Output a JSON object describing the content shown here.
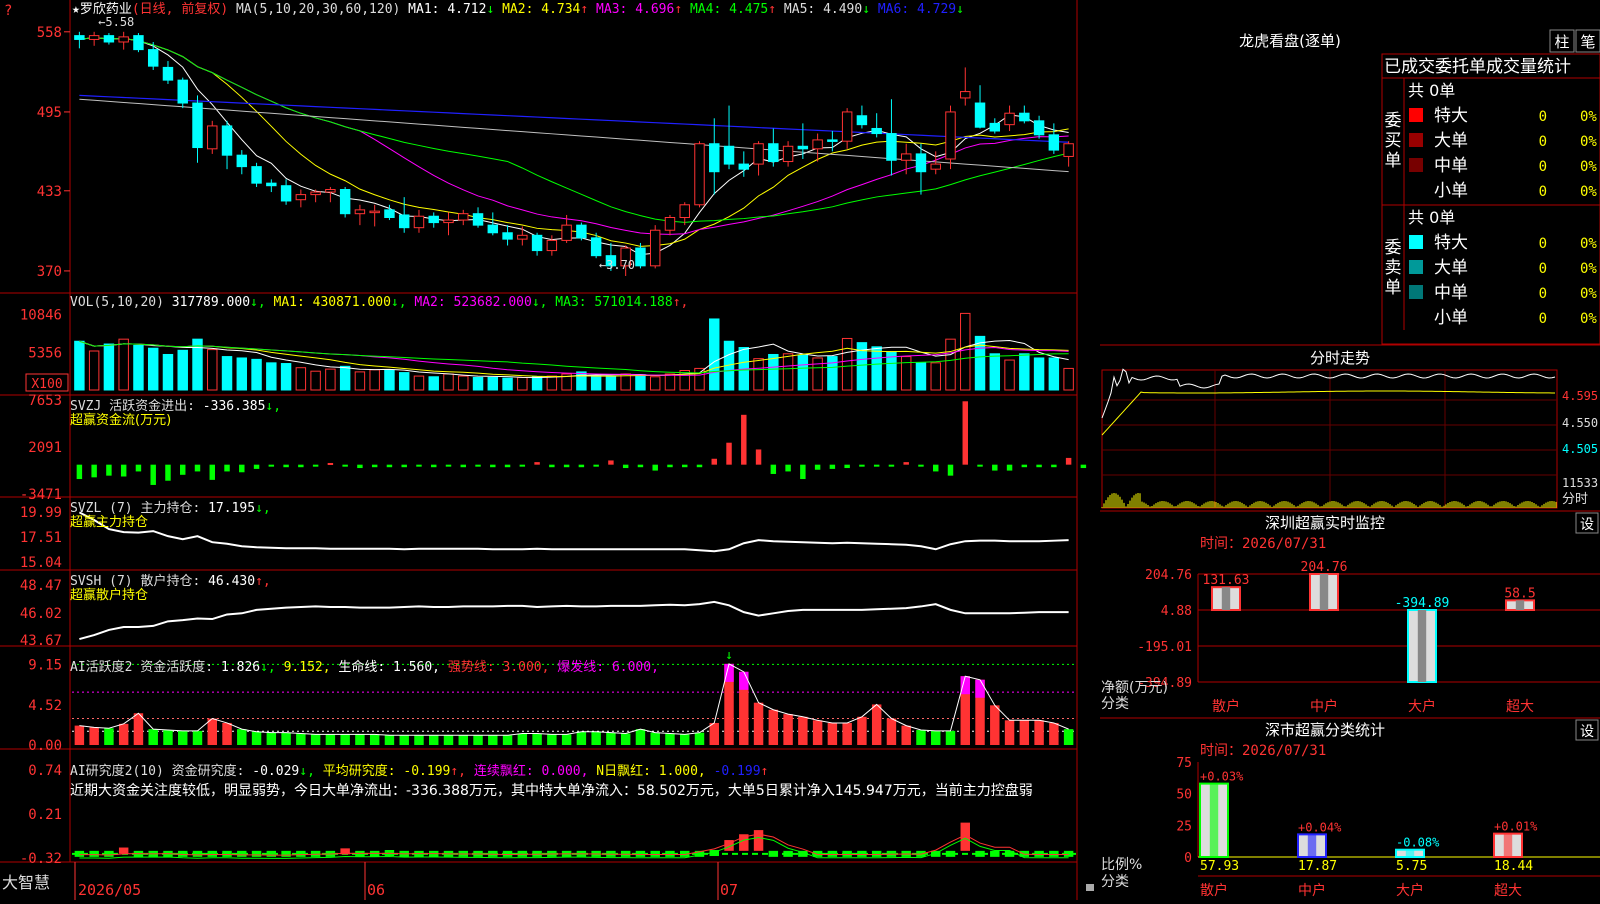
{
  "colors": {
    "up": "#ff3333",
    "down": "#00ffff",
    "ma1": "#ffffff",
    "ma2": "#ffff00",
    "ma3": "#ff00ff",
    "ma4": "#00ff00",
    "ma5": "#c0c0c0",
    "ma6": "#2020ff",
    "grid": "#b00000",
    "cyan": "#00ffff",
    "magenta": "#ff00ff",
    "green": "#00ff00",
    "yellow": "#ffff00",
    "red": "#ff3333"
  },
  "header": {
    "question": "?",
    "star": "★",
    "stock": "罗欣药业",
    "period": "(日线, 前复权)",
    "ma_label": "MA(5,10,20,30,60,120)",
    "mas": [
      {
        "n": "MA1",
        "v": "4.712",
        "a": "↓"
      },
      {
        "n": "MA2",
        "v": "4.734",
        "a": "↑"
      },
      {
        "n": "MA3",
        "v": "4.696",
        "a": "↑"
      },
      {
        "n": "MA4",
        "v": "4.475",
        "a": "↑"
      },
      {
        "n": "MA5",
        "v": "4.490",
        "a": "↓"
      },
      {
        "n": "MA6",
        "v": "4.729",
        "a": "↓"
      }
    ]
  },
  "price": {
    "hi_label": "5.58",
    "lo_label": "3.70",
    "y_labels": [
      "558",
      "495",
      "433",
      "370"
    ],
    "ylim": [
      3.55,
      5.72
    ],
    "high_arrow": "←",
    "low_arrow": "←"
  },
  "vol": {
    "title": "VOL(5,10,20)",
    "value": "317789.000",
    "v_arrow": "↓",
    "mas": [
      {
        "n": "MA1",
        "v": "430871.000",
        "a": "↓"
      },
      {
        "n": "MA2",
        "v": "523682.000",
        "a": "↓"
      },
      {
        "n": "MA3",
        "v": "571014.188",
        "a": "↑"
      }
    ],
    "y_labels": [
      "10846",
      "5356"
    ],
    "unit": "X100"
  },
  "svzj": {
    "code": "SVZJ",
    "name": "活跃资金进出",
    "value": "-336.385",
    "arrow": "↓",
    "sub": "超赢资金流(万元)",
    "y_labels": [
      "7653",
      "2091",
      "-3471"
    ]
  },
  "svzl": {
    "code": "SVZL (7)",
    "name": "主力持仓",
    "value": "17.195",
    "arrow": "↓",
    "sub": "超赢主力持仓",
    "y_labels": [
      "19.99",
      "17.51",
      "15.04"
    ]
  },
  "svsh": {
    "code": "SVSH (7)",
    "name": "散户持仓",
    "value": "46.430",
    "arrow": "↑",
    "sub": "超赢散户持仓",
    "y_labels": [
      "48.47",
      "46.02",
      "43.67"
    ]
  },
  "ai_hyd": {
    "code": "AI活跃度2",
    "name": "资金活跃度",
    "value": "1.826",
    "arrow": "↓",
    "v2": "9.152",
    "life": "生命线",
    "life_v": "1.560",
    "strong": "强势线",
    "strong_v": "3.000",
    "burst": "爆发线",
    "burst_v": "6.000",
    "y_labels": [
      "9.15",
      "4.52",
      "0.00"
    ]
  },
  "ai_yjd": {
    "code": "AI研究度2(10)",
    "name": "资金研究度",
    "value": "-0.029",
    "arrow": "↓",
    "avg": "平均研究度",
    "avg_v": "-0.199",
    "avg_a": "↑",
    "lx": "连续飘红",
    "lx_v": "0.000",
    "nr": "N日飘红",
    "nr_v": "1.000",
    "last": "-0.199",
    "last_a": "↑",
    "y_labels": [
      "0.74",
      "0.21",
      "-0.32"
    ],
    "comment": "近期大资金关注度较低，明显弱势，今日大单净流出：-336.388万元，其中特大单净流入：58.502万元，大单5日累计净入145.947万元，当前主力控盘弱"
  },
  "bottom": {
    "brand": "大智慧",
    "dates": [
      "2026/05",
      "06",
      "07"
    ]
  },
  "dragon": {
    "title": "龙虎看盘(逐单)",
    "btn1": "柱",
    "btn2": "笔",
    "subtitle": "已成交委托单成交量统计",
    "buy": {
      "side": "委买单",
      "total": "共 0单",
      "rows": [
        {
          "name": "特大",
          "n": "0",
          "p": "0%",
          "c": "#ff0000"
        },
        {
          "name": "大单",
          "n": "0",
          "p": "0%",
          "c": "#990000"
        },
        {
          "name": "中单",
          "n": "0",
          "p": "0%",
          "c": "#770000"
        },
        {
          "name": "小单",
          "n": "0",
          "p": "0%",
          "c": ""
        }
      ]
    },
    "sell": {
      "side": "委卖单",
      "total": "共 0单",
      "rows": [
        {
          "name": "特大",
          "n": "0",
          "p": "0%",
          "c": "#00ffff"
        },
        {
          "name": "大单",
          "n": "0",
          "p": "0%",
          "c": "#009999"
        },
        {
          "name": "中单",
          "n": "0",
          "p": "0%",
          "c": "#007777"
        },
        {
          "name": "小单",
          "n": "0",
          "p": "0%",
          "c": ""
        }
      ]
    }
  },
  "intraday": {
    "title": "分时走势",
    "y_labels": [
      "4.595",
      "4.550",
      "4.505"
    ],
    "vol_label": "11533",
    "tag": "分时"
  },
  "monitor": {
    "title": "深圳超赢实时监控",
    "btn": "设",
    "time_label": "时间：",
    "time": "2026/07/31",
    "y_labels": [
      "204.76",
      "4.88",
      "-195.01",
      "-394.89"
    ],
    "left_label": "净额(万元)",
    "cat_label": "分类",
    "bars": [
      {
        "cat": "散户",
        "v": 131.63,
        "label": "131.63"
      },
      {
        "cat": "中户",
        "v": 204.76,
        "label": "204.76"
      },
      {
        "cat": "大户",
        "v": -394.89,
        "label": "-394.89"
      },
      {
        "cat": "超大",
        "v": 58.5,
        "label": "58.5"
      }
    ]
  },
  "classify": {
    "title": "深市超赢分类统计",
    "btn": "设",
    "time_label": "时间：",
    "time": "2026/07/31",
    "y_labels": [
      "75",
      "50",
      "25",
      "0"
    ],
    "left_label": "比例%",
    "cat_label": "分类",
    "bars": [
      {
        "cat": "散户",
        "pct": 57.93,
        "label": "57.93",
        "chg": "+0.03%"
      },
      {
        "cat": "中户",
        "pct": 17.87,
        "label": "17.87",
        "chg": "+0.04%"
      },
      {
        "cat": "大户",
        "pct": 5.75,
        "label": "5.75",
        "chg": "-0.08%"
      },
      {
        "cat": "超大",
        "pct": 18.44,
        "label": "18.44",
        "chg": "+0.01%"
      }
    ]
  },
  "chart_data": {
    "type": "candlestick",
    "candles": [
      [
        5.55,
        5.58,
        5.45,
        5.52
      ],
      [
        5.52,
        5.58,
        5.47,
        5.55
      ],
      [
        5.55,
        5.57,
        5.48,
        5.5
      ],
      [
        5.5,
        5.58,
        5.44,
        5.54
      ],
      [
        5.55,
        5.57,
        5.42,
        5.44
      ],
      [
        5.44,
        5.5,
        5.28,
        5.31
      ],
      [
        5.3,
        5.35,
        5.17,
        5.2
      ],
      [
        5.2,
        5.22,
        4.98,
        5.02
      ],
      [
        5.02,
        5.08,
        4.55,
        4.67
      ],
      [
        4.66,
        4.88,
        4.62,
        4.84
      ],
      [
        4.84,
        4.88,
        4.5,
        4.61
      ],
      [
        4.61,
        4.65,
        4.46,
        4.52
      ],
      [
        4.52,
        4.55,
        4.36,
        4.39
      ],
      [
        4.39,
        4.42,
        4.32,
        4.37
      ],
      [
        4.37,
        4.42,
        4.22,
        4.25
      ],
      [
        4.26,
        4.34,
        4.2,
        4.3
      ],
      [
        4.3,
        4.34,
        4.24,
        4.32
      ],
      [
        4.32,
        4.36,
        4.24,
        4.34
      ],
      [
        4.34,
        4.36,
        4.12,
        4.15
      ],
      [
        4.15,
        4.22,
        4.06,
        4.18
      ],
      [
        4.16,
        4.22,
        4.05,
        4.17
      ],
      [
        4.18,
        4.22,
        4.1,
        4.12
      ],
      [
        4.14,
        4.28,
        4.0,
        4.04
      ],
      [
        4.04,
        4.18,
        4.0,
        4.13
      ],
      [
        4.13,
        4.16,
        4.04,
        4.08
      ],
      [
        4.08,
        4.16,
        3.98,
        4.1
      ],
      [
        4.1,
        4.18,
        4.06,
        4.15
      ],
      [
        4.15,
        4.2,
        4.04,
        4.06
      ],
      [
        4.06,
        4.16,
        3.98,
        4.0
      ],
      [
        4.0,
        4.06,
        3.9,
        3.95
      ],
      [
        3.95,
        4.05,
        3.9,
        3.98
      ],
      [
        3.98,
        4.0,
        3.82,
        3.86
      ],
      [
        3.86,
        3.98,
        3.82,
        3.94
      ],
      [
        3.94,
        4.14,
        3.92,
        4.06
      ],
      [
        4.06,
        4.08,
        3.94,
        3.96
      ],
      [
        3.96,
        4.0,
        3.8,
        3.82
      ],
      [
        3.82,
        3.92,
        3.7,
        3.74
      ],
      [
        3.74,
        3.9,
        3.66,
        3.88
      ],
      [
        3.88,
        3.92,
        3.72,
        3.74
      ],
      [
        3.74,
        4.06,
        3.72,
        4.02
      ],
      [
        4.02,
        4.14,
        3.98,
        4.12
      ],
      [
        4.12,
        4.24,
        4.06,
        4.22
      ],
      [
        4.22,
        4.72,
        4.2,
        4.7
      ],
      [
        4.7,
        4.9,
        4.3,
        4.48
      ],
      [
        4.68,
        5.0,
        4.5,
        4.54
      ],
      [
        4.54,
        4.64,
        4.44,
        4.5
      ],
      [
        4.54,
        4.72,
        4.45,
        4.7
      ],
      [
        4.7,
        4.82,
        4.52,
        4.56
      ],
      [
        4.56,
        4.72,
        4.52,
        4.68
      ],
      [
        4.68,
        4.86,
        4.58,
        4.66
      ],
      [
        4.66,
        4.78,
        4.56,
        4.73
      ],
      [
        4.73,
        4.8,
        4.64,
        4.72
      ],
      [
        4.72,
        4.98,
        4.66,
        4.95
      ],
      [
        4.92,
        5.0,
        4.82,
        4.85
      ],
      [
        4.82,
        4.94,
        4.75,
        4.78
      ],
      [
        4.78,
        5.05,
        4.45,
        4.57
      ],
      [
        4.57,
        4.7,
        4.46,
        4.62
      ],
      [
        4.62,
        4.7,
        4.3,
        4.48
      ],
      [
        4.5,
        4.64,
        4.46,
        4.54
      ],
      [
        4.58,
        5.0,
        4.5,
        4.95
      ],
      [
        5.06,
        5.3,
        5.0,
        5.11
      ],
      [
        5.02,
        5.16,
        4.82,
        4.83
      ],
      [
        4.86,
        4.9,
        4.78,
        4.8
      ],
      [
        4.85,
        5.0,
        4.8,
        4.94
      ],
      [
        4.94,
        5.0,
        4.86,
        4.88
      ],
      [
        4.88,
        4.92,
        4.74,
        4.77
      ],
      [
        4.77,
        4.86,
        4.62,
        4.65
      ],
      [
        4.6,
        4.72,
        4.52,
        4.7
      ]
    ],
    "vol": [
      7000,
      5600,
      6600,
      7300,
      6400,
      6000,
      5100,
      5700,
      7300,
      5800,
      4800,
      4600,
      4400,
      3900,
      3800,
      3200,
      2700,
      3000,
      3400,
      2600,
      2900,
      2900,
      2500,
      2000,
      1900,
      2300,
      2000,
      1800,
      1800,
      1700,
      1800,
      1900,
      2000,
      2300,
      2600,
      2000,
      2000,
      2300,
      2200,
      1900,
      2300,
      2800,
      3100,
      10200,
      7000,
      6100,
      4500,
      5100,
      5200,
      5000,
      4600,
      4800,
      7400,
      6800,
      6200,
      5500,
      4800,
      3900,
      3900,
      7300,
      11000,
      7700,
      5200,
      4300,
      5200,
      4600,
      4600,
      3100
    ],
    "svzj": [
      -1700,
      -1500,
      -1300,
      -1400,
      -800,
      -2400,
      -1900,
      -1200,
      -800,
      -1800,
      -800,
      -900,
      -500,
      -200,
      -300,
      -300,
      -200,
      200,
      -200,
      -400,
      -300,
      -300,
      -300,
      -200,
      -300,
      -200,
      -300,
      -200,
      -300,
      -300,
      -200,
      300,
      -300,
      -300,
      -300,
      -200,
      500,
      -400,
      -300,
      -700,
      -300,
      -300,
      -300,
      700,
      2600,
      5900,
      1800,
      -1100,
      -800,
      -1700,
      -600,
      -500,
      -400,
      -200,
      -200,
      -200,
      300,
      -200,
      -800,
      -1300,
      7500,
      -200,
      -700,
      -700,
      -300,
      -300,
      -300,
      800,
      -400
    ],
    "svzl": [
      19.95,
      19.2,
      18.3,
      18.0,
      17.95,
      18.1,
      17.6,
      17.3,
      17.6,
      17.0,
      16.85,
      16.6,
      16.5,
      16.45,
      16.4,
      16.4,
      16.4,
      16.35,
      16.35,
      16.35,
      16.35,
      16.35,
      16.3,
      16.35,
      16.35,
      16.35,
      16.35,
      16.35,
      16.3,
      16.3,
      16.3,
      16.35,
      16.3,
      16.3,
      16.3,
      16.3,
      16.3,
      16.3,
      16.3,
      16.3,
      16.3,
      16.3,
      16.2,
      16.1,
      16.3,
      16.9,
      17.2,
      17.1,
      17.05,
      17.0,
      16.95,
      16.9,
      16.95,
      16.9,
      16.85,
      16.8,
      16.75,
      16.6,
      16.3,
      16.8,
      17.1,
      17.15,
      17.15,
      17.1,
      17.1,
      17.1,
      17.15,
      17.2
    ],
    "svsh": [
      43.75,
      44.1,
      44.55,
      44.8,
      44.8,
      44.9,
      45.3,
      45.4,
      45.55,
      45.5,
      45.9,
      46.0,
      46.3,
      46.4,
      46.5,
      46.55,
      46.6,
      46.55,
      46.55,
      46.5,
      46.5,
      46.5,
      46.55,
      46.6,
      46.55,
      46.55,
      46.6,
      46.6,
      46.6,
      46.65,
      46.65,
      46.55,
      46.6,
      46.65,
      46.6,
      46.6,
      46.65,
      46.65,
      46.65,
      46.7,
      46.75,
      46.7,
      46.8,
      47.0,
      46.7,
      46.1,
      45.8,
      46.0,
      46.2,
      46.3,
      46.3,
      46.3,
      46.3,
      46.3,
      46.35,
      46.4,
      46.45,
      46.6,
      46.8,
      46.3,
      46.0,
      46.0,
      46.0,
      46.0,
      46.05,
      46.1,
      46.1,
      46.1
    ],
    "ai_hyd": [
      2.2,
      2.0,
      1.9,
      2.4,
      3.6,
      1.8,
      1.7,
      1.6,
      1.6,
      3.0,
      2.5,
      1.8,
      1.5,
      1.4,
      1.4,
      1.3,
      1.2,
      1.2,
      1.2,
      1.2,
      1.2,
      1.1,
      1.1,
      1.1,
      1.1,
      1.1,
      1.1,
      1.1,
      1.1,
      1.1,
      1.3,
      1.3,
      1.2,
      1.2,
      1.5,
      1.5,
      1.4,
      1.3,
      1.8,
      1.4,
      1.3,
      1.2,
      1.4,
      2.5,
      9.2,
      8.3,
      4.8,
      4.0,
      3.5,
      3.2,
      2.8,
      2.5,
      2.5,
      3.2,
      4.6,
      3.0,
      2.2,
      1.7,
      1.6,
      1.6,
      7.8,
      7.4,
      4.5,
      2.8,
      2.8,
      2.8,
      2.5,
      1.8
    ],
    "ai_yjd": [
      -0.28,
      -0.28,
      -0.29,
      -0.23,
      -0.27,
      -0.29,
      -0.28,
      -0.27,
      -0.29,
      -0.27,
      -0.28,
      -0.29,
      -0.29,
      -0.28,
      -0.28,
      -0.27,
      -0.27,
      -0.27,
      -0.24,
      -0.28,
      -0.27,
      -0.26,
      -0.27,
      -0.27,
      -0.27,
      -0.27,
      -0.28,
      -0.27,
      -0.28,
      -0.28,
      -0.27,
      -0.27,
      -0.27,
      -0.27,
      -0.27,
      -0.28,
      -0.28,
      -0.27,
      -0.28,
      -0.28,
      -0.28,
      -0.27,
      -0.27,
      -0.26,
      -0.14,
      -0.07,
      -0.02,
      -0.28,
      -0.28,
      -0.27,
      -0.28,
      -0.28,
      -0.28,
      -0.27,
      -0.28,
      -0.27,
      -0.27,
      -0.28,
      -0.28,
      -0.28,
      0.07,
      -0.27,
      -0.28,
      -0.28,
      -0.27,
      -0.28,
      -0.28,
      -0.28
    ]
  }
}
